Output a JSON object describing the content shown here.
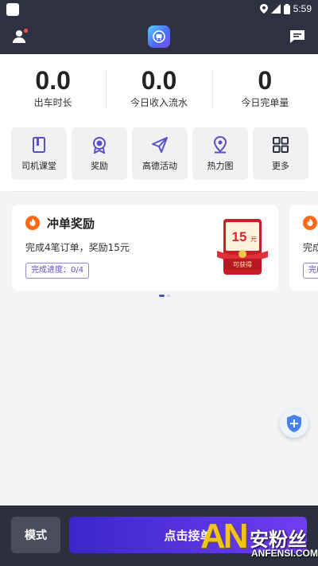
{
  "status_bar": {
    "time": "5:59"
  },
  "stats": [
    {
      "value": "0.0",
      "label": "出车时长"
    },
    {
      "value": "0.0",
      "label": "今日收入流水"
    },
    {
      "value": "0",
      "label": "今日完单量"
    }
  ],
  "quick_actions": [
    {
      "label": "司机课堂",
      "icon": "book-icon"
    },
    {
      "label": "奖励",
      "icon": "medal-icon"
    },
    {
      "label": "高德活动",
      "icon": "paper-plane-icon"
    },
    {
      "label": "热力图",
      "icon": "map-pin-icon"
    },
    {
      "label": "更多",
      "icon": "grid-icon"
    }
  ],
  "reward_card": {
    "title": "冲单奖励",
    "description": "完成4笔订单，奖励15元",
    "progress": "完成进度：0/4",
    "envelope_amount": "15",
    "envelope_unit": "元",
    "envelope_caption": "可获得"
  },
  "peek_card": {
    "description": "完成",
    "progress": "完成"
  },
  "bottom": {
    "mode_label": "模式",
    "accept_label": "点击接单"
  },
  "watermark": {
    "logo": "AN",
    "name": "安粉丝",
    "domain": "ANFENSI.COM"
  },
  "colors": {
    "header": "#2d3142",
    "accent": "#5b4fc7",
    "accept_button": "#4a2fe0",
    "envelope": "#d8262d"
  }
}
